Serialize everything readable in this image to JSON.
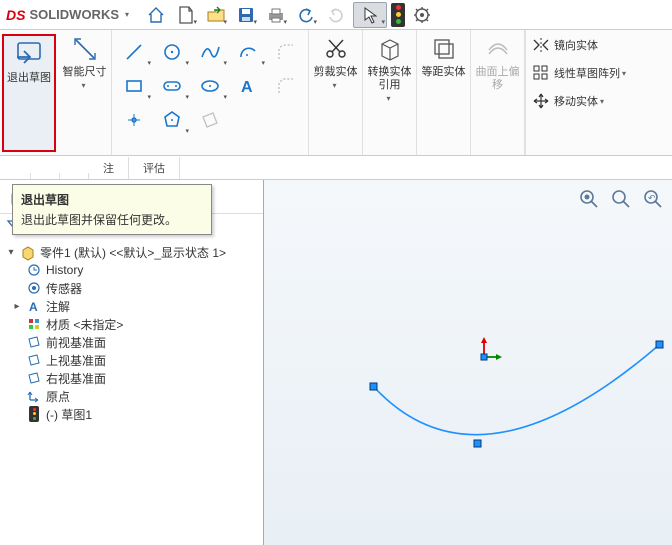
{
  "brand": {
    "ds_logo": "DS",
    "name": "SOLIDWORKS"
  },
  "ribbon": {
    "exit_sketch": "退出草图",
    "smart_dim": "智能尺寸",
    "trim": "剪裁实体",
    "convert": "转换实体引用",
    "offset": "等距实体",
    "offset_surface": "曲面上偏移",
    "mirror": "镜向实体",
    "linear_pattern": "线性草图阵列",
    "move": "移动实体"
  },
  "tooltip": {
    "title": "退出草图",
    "body": "退出此草图并保留任何更改。"
  },
  "tabs": {
    "annotate": "注",
    "evaluate": "评估"
  },
  "tree": {
    "root": "零件1 (默认) <<默认>_显示状态 1>",
    "history": "History",
    "sensors": "传感器",
    "annotations": "注解",
    "material": "材质 <未指定>",
    "front_plane": "前视基准面",
    "top_plane": "上视基准面",
    "right_plane": "右视基准面",
    "origin": "原点",
    "sketch1": "(-) 草图1"
  },
  "colors": {
    "brand_red": "#d9000d",
    "sketch_blue": "#0078d7",
    "curve_blue": "#1e90ff",
    "handle_blue": "#0066cc"
  }
}
